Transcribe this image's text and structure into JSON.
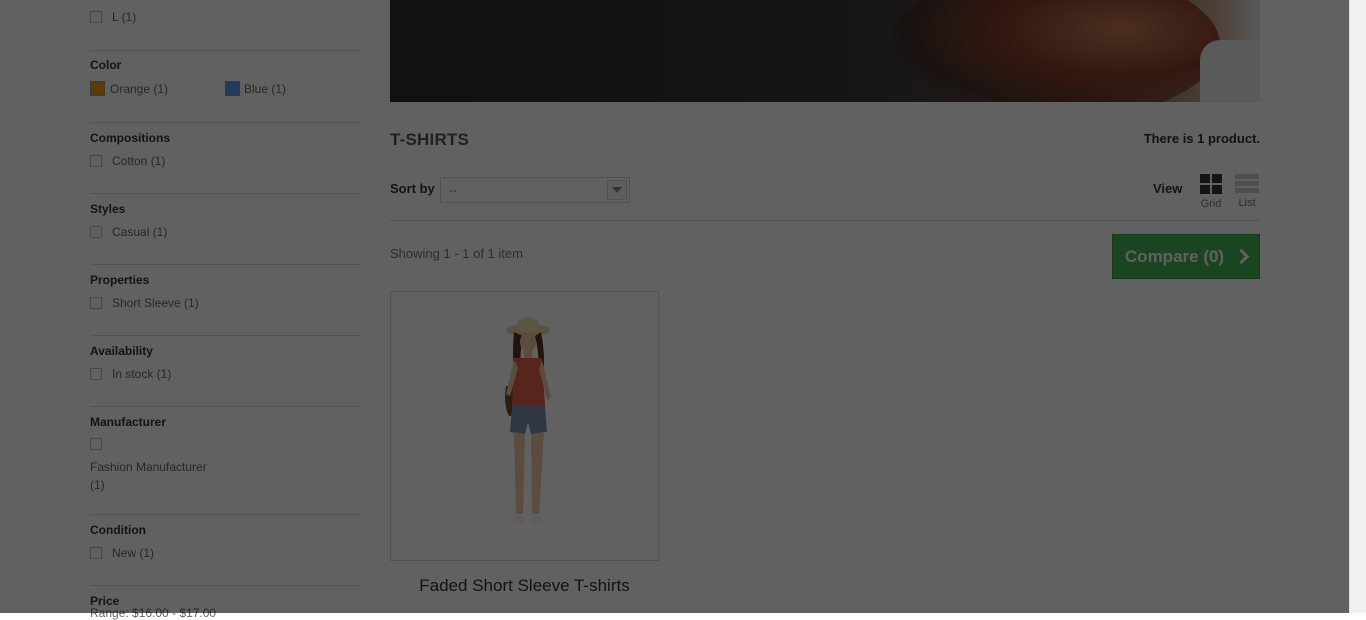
{
  "filters": {
    "size_partial": {
      "label": "L (1)"
    },
    "color": {
      "title": "Color",
      "options": [
        {
          "label": "Orange (1)",
          "color": "#f39c11"
        },
        {
          "label": "Blue (1)",
          "color": "#5d9cec"
        }
      ]
    },
    "compositions": {
      "title": "Compositions",
      "options": [
        {
          "label": "Cotton (1)"
        }
      ]
    },
    "styles": {
      "title": "Styles",
      "options": [
        {
          "label": "Casual (1)"
        }
      ]
    },
    "properties": {
      "title": "Properties",
      "options": [
        {
          "label": "Short Sleeve (1)"
        }
      ]
    },
    "availability": {
      "title": "Availability",
      "options": [
        {
          "label": "In stock (1)"
        }
      ]
    },
    "manufacturer": {
      "title": "Manufacturer",
      "options": [
        {
          "label": "Fashion Manufacturer",
          "count": "(1)"
        }
      ]
    },
    "condition": {
      "title": "Condition",
      "options": [
        {
          "label": "New (1)"
        }
      ]
    },
    "price": {
      "title": "Price",
      "range_text": "Range: $16.00 - $17.00"
    }
  },
  "category": {
    "title": "T-SHIRTS",
    "product_count": "There is 1 product."
  },
  "sort": {
    "label": "Sort by",
    "selected": "--"
  },
  "view": {
    "label": "View",
    "grid": "Grid",
    "list": "List"
  },
  "listing": {
    "showing": "Showing 1 - 1 of 1 item"
  },
  "compare": {
    "label": "Compare (0)"
  },
  "product": {
    "name": "Faded Short Sleeve T-shirts"
  }
}
